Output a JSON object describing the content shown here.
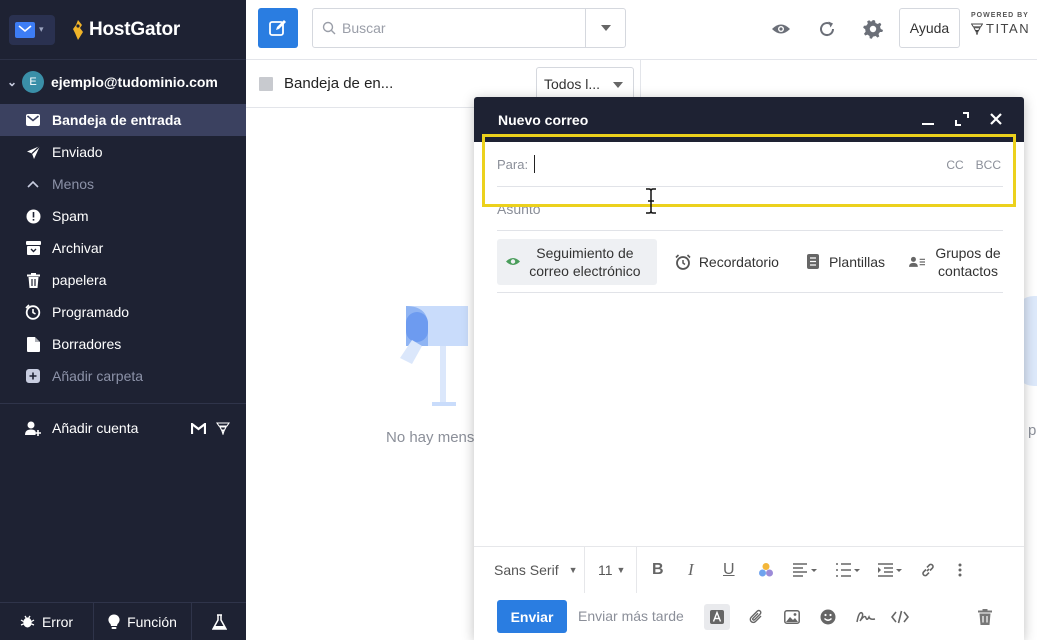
{
  "brand": {
    "name": "HostGator",
    "powered_by": "POWERED BY",
    "partner": "TITAN"
  },
  "account": {
    "initial": "E",
    "email": "ejemplo@tudominio.com"
  },
  "folders": [
    {
      "label": "Bandeja de entrada",
      "icon": "inbox-icon",
      "active": true
    },
    {
      "label": "Enviado",
      "icon": "send-icon"
    },
    {
      "label": "Menos",
      "icon": "chevron-up-icon"
    },
    {
      "label": "Spam",
      "icon": "spam-icon"
    },
    {
      "label": "Archivar",
      "icon": "archive-icon"
    },
    {
      "label": "papelera",
      "icon": "trash-icon"
    },
    {
      "label": "Programado",
      "icon": "scheduled-icon"
    },
    {
      "label": "Borradores",
      "icon": "drafts-icon"
    },
    {
      "label": "Añadir carpeta",
      "icon": "add-folder-icon"
    }
  ],
  "add_account": {
    "label": "Añadir cuenta"
  },
  "sidebar_footer": {
    "error": "Error",
    "feature": "Función"
  },
  "topbar": {
    "search_placeholder": "Buscar",
    "help": "Ayuda"
  },
  "list": {
    "title": "Bandeja de en...",
    "filter": "Todos l...",
    "empty_text": "No hay mens",
    "right_empty_text": "p"
  },
  "compose": {
    "title": "Nuevo correo",
    "to_label": "Para:",
    "cc": "CC",
    "bcc": "BCC",
    "subject_placeholder": "Asunto",
    "features": {
      "tracking": "Seguimiento de correo electrónico",
      "reminder": "Recordatorio",
      "templates": "Plantillas",
      "groups": "Grupos de contactos"
    },
    "format": {
      "font": "Sans Serif",
      "size": "11"
    },
    "send": "Enviar",
    "send_later": "Enviar más tarde"
  },
  "colors": {
    "sidebar": "#1e2233",
    "accent": "#2a7de1",
    "highlight": "#ecd11c"
  }
}
